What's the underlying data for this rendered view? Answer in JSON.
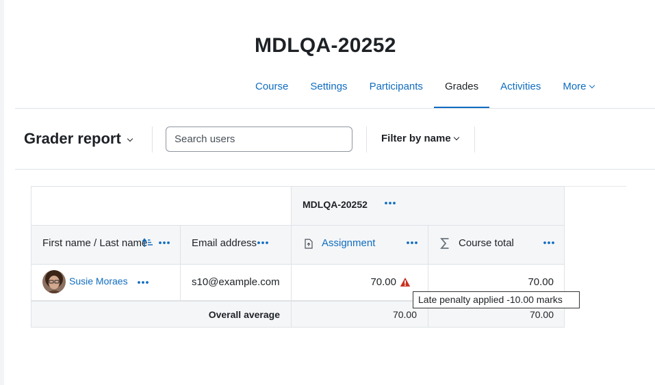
{
  "page": {
    "title": "MDLQA-20252"
  },
  "nav": {
    "tabs": [
      {
        "label": "Course",
        "active": false
      },
      {
        "label": "Settings",
        "active": false
      },
      {
        "label": "Participants",
        "active": false
      },
      {
        "label": "Grades",
        "active": true
      },
      {
        "label": "Activities",
        "active": false
      },
      {
        "label": "More",
        "active": false
      }
    ]
  },
  "toolbar": {
    "report_title": "Grader report",
    "search": {
      "placeholder": "Search users",
      "value": ""
    },
    "filter_label": "Filter by name"
  },
  "table": {
    "category_header": "MDLQA-20252",
    "columns": {
      "name": "First name / Last name",
      "email": "Email address",
      "assignment": "Assignment",
      "course_total": "Course total"
    },
    "rows": [
      {
        "name": "Susie Moraes",
        "email": "s10@example.com",
        "assignment": "70.00",
        "course_total": "70.00"
      }
    ],
    "footer": {
      "label": "Overall average",
      "assignment": "70.00",
      "course_total": "70.00"
    }
  },
  "tooltip": {
    "text": "Late penalty applied -10.00 marks"
  },
  "colors": {
    "link": "#0f6cbf",
    "warning": "#ca3120",
    "border": "#dee2e6",
    "header_bg": "#f5f6f8"
  }
}
